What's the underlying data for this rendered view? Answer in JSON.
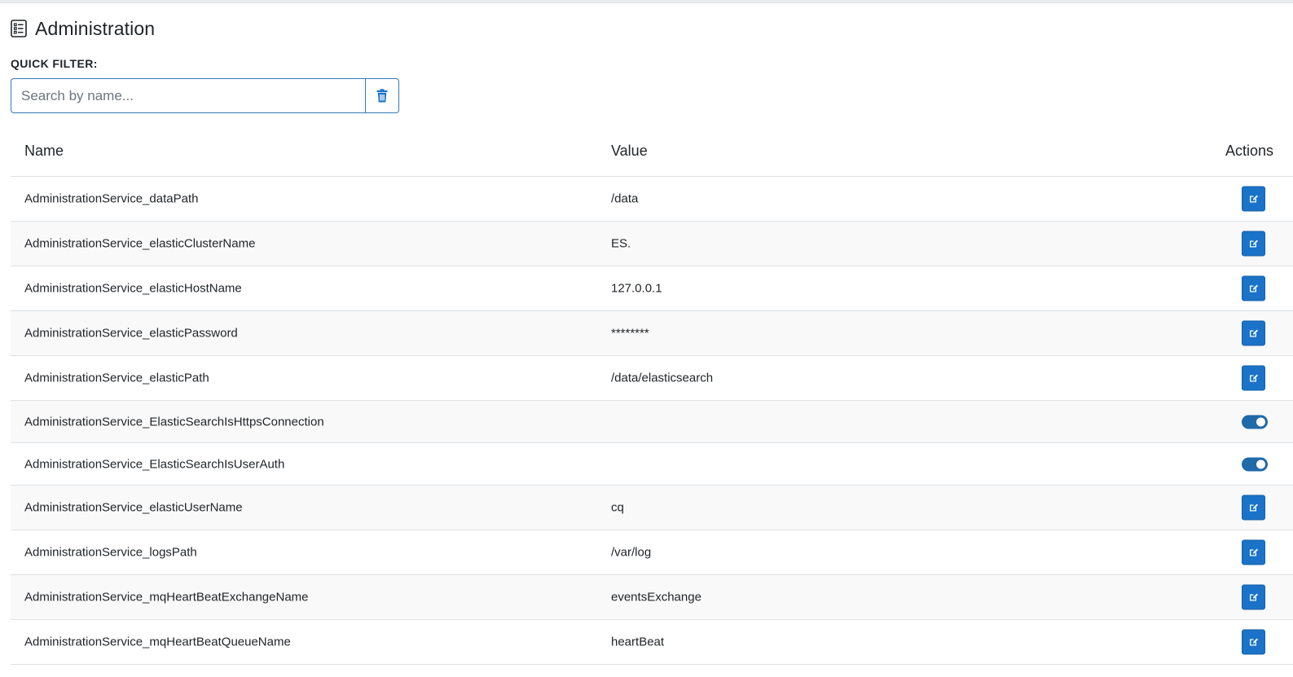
{
  "page": {
    "title": "Administration",
    "title_icon": "list-checklist-icon"
  },
  "filter": {
    "label": "QUICK FILTER:",
    "placeholder": "Search by name...",
    "value": "",
    "clear_icon": "trash-icon"
  },
  "table": {
    "headers": {
      "name": "Name",
      "value": "Value",
      "actions": "Actions"
    },
    "rows": [
      {
        "name": "AdministrationService_dataPath",
        "value": "/data",
        "action": "edit"
      },
      {
        "name": "AdministrationService_elasticClusterName",
        "value": "ES.",
        "action": "edit"
      },
      {
        "name": "AdministrationService_elasticHostName",
        "value": "127.0.0.1",
        "action": "edit"
      },
      {
        "name": "AdministrationService_elasticPassword",
        "value": "********",
        "action": "edit"
      },
      {
        "name": "AdministrationService_elasticPath",
        "value": "/data/elasticsearch",
        "action": "edit"
      },
      {
        "name": "AdministrationService_ElasticSearchIsHttpsConnection",
        "value": "",
        "action": "toggle",
        "toggle_on": true
      },
      {
        "name": "AdministrationService_ElasticSearchIsUserAuth",
        "value": "",
        "action": "toggle",
        "toggle_on": true
      },
      {
        "name": "AdministrationService_elasticUserName",
        "value": "cq",
        "action": "edit"
      },
      {
        "name": "AdministrationService_logsPath",
        "value": "/var/log",
        "action": "edit"
      },
      {
        "name": "AdministrationService_mqHeartBeatExchangeName",
        "value": "eventsExchange",
        "action": "edit"
      },
      {
        "name": "AdministrationService_mqHeartBeatQueueName",
        "value": "heartBeat",
        "action": "edit"
      }
    ]
  },
  "colors": {
    "accent": "#1a73c8",
    "toggle_on": "#1f6aa8",
    "row_alt": "#f9f9f9",
    "border": "#dee2e6"
  }
}
